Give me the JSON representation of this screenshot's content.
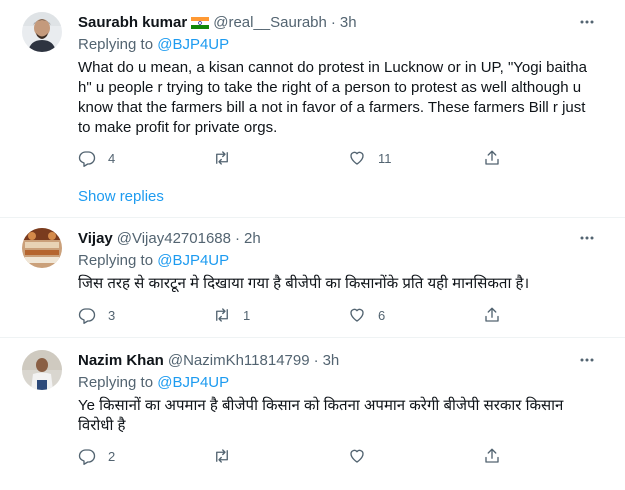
{
  "replying_to_label": "Replying to",
  "tweets": [
    {
      "name": "Saurabh kumar",
      "handle": "@real__Saurabh",
      "separator": "·",
      "time": "3h",
      "reply_target": "@BJP4UP",
      "text": "What do u mean, a kisan cannot do protest in Lucknow or in UP, \"Yogi baitha h\" u people r trying to take the right of a person to protest as well although u know that the farmers bill a not in favor of a farmers. These farmers Bill r just to make profit for private orgs.",
      "replies": "4",
      "retweets": "",
      "likes": "11",
      "show_replies": "Show replies"
    },
    {
      "name": "Vijay",
      "handle": "@Vijay42701688",
      "separator": "·",
      "time": "2h",
      "reply_target": "@BJP4UP",
      "text": "जिस तरह से कारटून मे दिखाया गया है बीजेपी का किसानोंके  प्रति यही मानसिकता है।",
      "replies": "3",
      "retweets": "1",
      "likes": "6"
    },
    {
      "name": "Nazim Khan",
      "handle": "@NazimKh11814799",
      "separator": "·",
      "time": "3h",
      "reply_target": "@BJP4UP",
      "text": "Ye किसानों का अपमान है बीजेपी किसान को कितना अपमान करेगी बीजेपी सरकार किसान विरोधी है",
      "replies": "2",
      "retweets": "",
      "likes": ""
    }
  ],
  "colors": {
    "text": "#0f1419",
    "secondary": "#536471",
    "accent": "#1d9bf0",
    "divider": "#eff3f4"
  },
  "icons": [
    "reply-icon",
    "retweet-icon",
    "like-icon",
    "share-icon",
    "more-icon",
    "india-flag-icon"
  ]
}
